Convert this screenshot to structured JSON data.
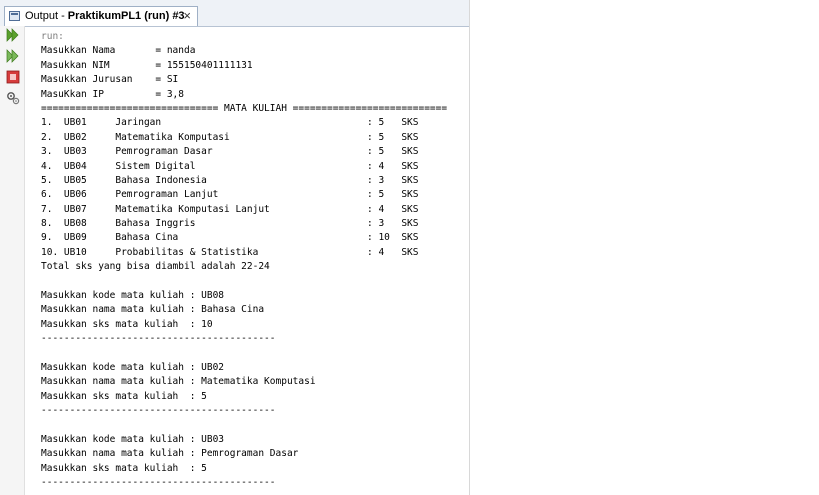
{
  "tab": {
    "prefix": "Output - ",
    "title": "PraktikumPL1 (run) #3",
    "close": "×"
  },
  "toolbar": {
    "buttons": [
      {
        "icon": "rerun-icon"
      },
      {
        "icon": "rerun-with-options-icon"
      },
      {
        "icon": "stop-icon"
      },
      {
        "icon": "settings-icon"
      }
    ]
  },
  "console": {
    "lines": [
      "run:",
      "Masukkan Nama       = nanda",
      "Masukkan NIM        = 155150401111131",
      "Masukkan Jurusan    = SI",
      "MasuKkan IP         = 3,8",
      "=============================== MATA KULIAH ===========================",
      "1.  UB01     Jaringan                                    : 5   SKS",
      "2.  UB02     Matematika Komputasi                        : 5   SKS",
      "3.  UB03     Pemrograman Dasar                           : 5   SKS",
      "4.  UB04     Sistem Digital                              : 4   SKS",
      "5.  UB05     Bahasa Indonesia                            : 3   SKS",
      "6.  UB06     Pemrograman Lanjut                          : 5   SKS",
      "7.  UB07     Matematika Komputasi Lanjut                 : 4   SKS",
      "8.  UB08     Bahasa Inggris                              : 3   SKS",
      "9.  UB09     Bahasa Cina                                 : 10  SKS",
      "10. UB10     Probabilitas & Statistika                   : 4   SKS",
      "Total sks yang bisa diambil adalah 22-24",
      "",
      "Masukkan kode mata kuliah : UB08",
      "Masukkan nama mata kuliah : Bahasa Cina",
      "Masukkan sks mata kuliah  : 10",
      "-----------------------------------------",
      "",
      "Masukkan kode mata kuliah : UB02",
      "Masukkan nama mata kuliah : Matematika Komputasi",
      "Masukkan sks mata kuliah  : 5",
      "-----------------------------------------",
      "",
      "Masukkan kode mata kuliah : UB03",
      "Masukkan nama mata kuliah : Pemrograman Dasar",
      "Masukkan sks mata kuliah  : 5",
      "-----------------------------------------"
    ]
  },
  "colors": {
    "run_text": "#808080",
    "rerun_green": "#5aa02c",
    "stop_red": "#d63c3c"
  }
}
